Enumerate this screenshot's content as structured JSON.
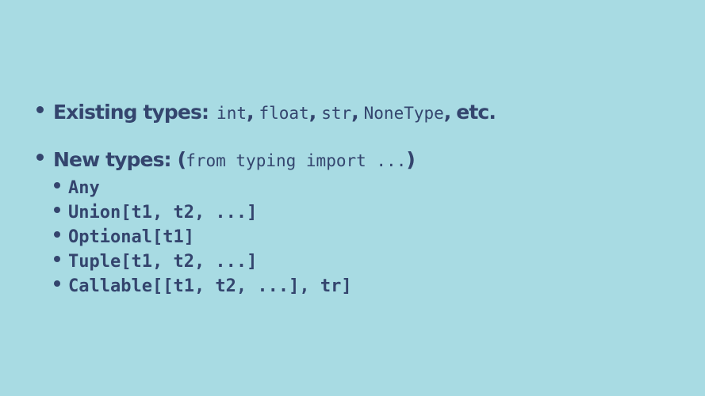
{
  "slide": {
    "existing": {
      "label": "Existing types:",
      "types": [
        "int",
        "float",
        "str",
        "NoneType"
      ],
      "separator": ",",
      "suffix": "etc."
    },
    "new": {
      "label": "New types:",
      "open_paren": "(",
      "import_code": "from typing import ...",
      "close_paren": ")",
      "items": [
        "Any",
        "Union[t1, t2, ...]",
        "Optional[t1]",
        "Tuple[t1, t2, ...]",
        "Callable[[t1, t2, ...], tr]"
      ]
    },
    "colors": {
      "background": "#a8dbe3",
      "text": "#34456e"
    }
  }
}
